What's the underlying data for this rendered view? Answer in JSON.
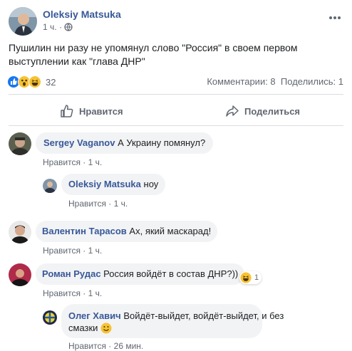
{
  "post": {
    "author": "Oleksiy Matsuka",
    "time": "1 ч.",
    "text_line1": "Пушилин ни разу не упомянул слово \"Россия\" в своем первом",
    "text_line2": "выступлении как \"глава ДНР\"",
    "reactions_count": "32",
    "comments_label": "Комментарии: 8",
    "shares_label": "Поделились: 1",
    "more_icon": "more-dots-icon",
    "privacy_icon": "globe-icon"
  },
  "actions": {
    "like_label": "Нравится",
    "share_label": "Поделиться"
  },
  "comments": [
    {
      "author": "Sergey Vaganov",
      "text": "А Украину помянул?",
      "like": "Нравится",
      "time": "1 ч."
    },
    {
      "author": "Oleksiy Matsuka",
      "text": "ноу",
      "like": "Нравится",
      "time": "1 ч."
    },
    {
      "author": "Валентин Тарасов",
      "text": "Ах, який маскарад!",
      "like": "Нравится",
      "time": "1 ч."
    },
    {
      "author": "Роман Рудас",
      "text": "Россия войдёт в состав ДНР?))",
      "like": "Нравится",
      "time": "1 ч.",
      "reaction_count": "1"
    },
    {
      "author": "Олег Хавич",
      "text_line1": "Войдёт-выйдет, войдёт-выйдет, и без",
      "text_line2": "смазки",
      "like": "Нравится",
      "time": "26 мин."
    }
  ],
  "separator": "·",
  "colors": {
    "link": "#385898",
    "gray": "#606770",
    "like_blue": "#1877f2",
    "bubble": "#f2f3f5"
  }
}
